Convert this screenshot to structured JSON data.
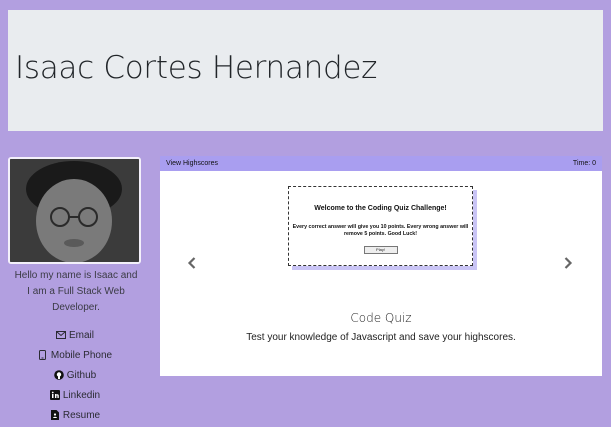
{
  "header": {
    "title": "Isaac Cortes Hernandez"
  },
  "profile": {
    "bio": "Hello my name is Isaac and I am a Full Stack Web Developer."
  },
  "links": [
    {
      "label": "Email",
      "icon": "envelope-icon"
    },
    {
      "label": "Mobile Phone",
      "icon": "phone-icon"
    },
    {
      "label": "Github",
      "icon": "github-icon"
    },
    {
      "label": "Linkedin",
      "icon": "linkedin-icon"
    },
    {
      "label": "Resume",
      "icon": "document-icon"
    }
  ],
  "carousel": {
    "topbar": {
      "highscores": "View Highscores",
      "time": "Time: 0"
    },
    "quiz": {
      "title": "Welcome to the Coding Quiz Challenge!",
      "description": "Every correct answer will give you 10 points. Every wrong answer will remove 5 points. Good Luck!",
      "button": "Play!"
    },
    "caption": {
      "title": "Code Quiz",
      "text": "Test your knowledge of Javascript and save your highscores."
    }
  },
  "colors": {
    "page_bg": "#b29fe0",
    "header_bg": "#e9ecef",
    "topbar_bg": "#a99ef0"
  }
}
